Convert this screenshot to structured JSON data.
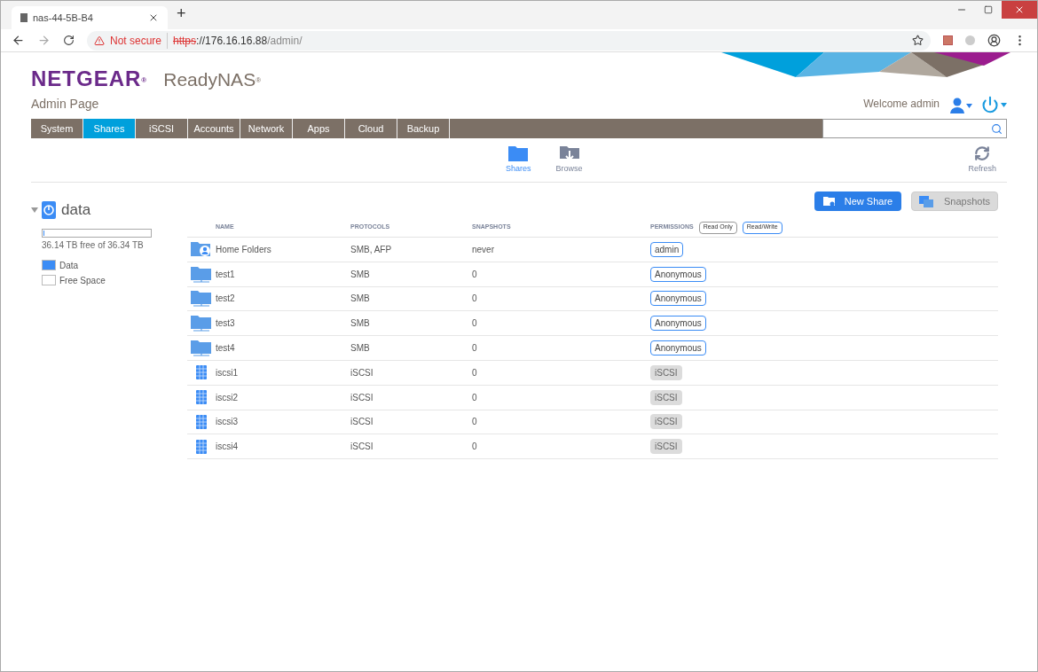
{
  "browser": {
    "tab_title": "nas-44-5B-B4",
    "new_tab": "+",
    "security": "Not secure",
    "url_scheme": "https",
    "url_rest": "://176.16.16.88",
    "url_path": "/admin/"
  },
  "header": {
    "brand": "NETGEAR",
    "brand_mark": "®",
    "product": "ReadyNAS",
    "product_mark": "®",
    "subtitle": "Admin Page",
    "welcome": "Welcome admin"
  },
  "nav": [
    {
      "label": "System",
      "selected": false
    },
    {
      "label": "Shares",
      "selected": true
    },
    {
      "label": "iSCSI",
      "selected": false
    },
    {
      "label": "Accounts",
      "selected": false
    },
    {
      "label": "Network",
      "selected": false
    },
    {
      "label": "Apps",
      "selected": false
    },
    {
      "label": "Cloud",
      "selected": false
    },
    {
      "label": "Backup",
      "selected": false
    }
  ],
  "toolbar": [
    {
      "label": "Shares",
      "kind": "shares",
      "selected": true
    },
    {
      "label": "Browse",
      "kind": "browse",
      "selected": false
    }
  ],
  "refresh": "Refresh",
  "volume": {
    "name": "data",
    "expanded": true,
    "level": 0.006,
    "free_text": "36.14 TB free of 36.34 TB",
    "legend": [
      {
        "label": "Data",
        "color": "#3b8cf5"
      },
      {
        "label": "Free Space",
        "color": "#ffffff"
      }
    ]
  },
  "actions": {
    "new_share": "New Share",
    "snapshots": "Snapshots"
  },
  "table": {
    "columns": [
      "NAME",
      "PROTOCOLS",
      "SNAPSHOTS",
      "PERMISSIONS"
    ],
    "filters": [
      {
        "label": "Read Only",
        "selected": false
      },
      {
        "label": "Read/Write",
        "selected": true
      }
    ],
    "rows": [
      {
        "kind": "home",
        "name": "Home Folders",
        "protocols": "SMB, AFP",
        "snapshots": "never",
        "permission": "admin"
      },
      {
        "kind": "folder",
        "name": "test1",
        "protocols": "SMB",
        "snapshots": "0",
        "permission": "Anonymous"
      },
      {
        "kind": "folder",
        "name": "test2",
        "protocols": "SMB",
        "snapshots": "0",
        "permission": "Anonymous"
      },
      {
        "kind": "folder",
        "name": "test3",
        "protocols": "SMB",
        "snapshots": "0",
        "permission": "Anonymous"
      },
      {
        "kind": "folder",
        "name": "test4",
        "protocols": "SMB",
        "snapshots": "0",
        "permission": "Anonymous"
      },
      {
        "kind": "iscsi",
        "name": "iscsi1",
        "protocols": "iSCSI",
        "snapshots": "0",
        "permission": "iSCSI"
      },
      {
        "kind": "iscsi",
        "name": "iscsi2",
        "protocols": "iSCSI",
        "snapshots": "0",
        "permission": "iSCSI"
      },
      {
        "kind": "iscsi",
        "name": "iscsi3",
        "protocols": "iSCSI",
        "snapshots": "0",
        "permission": "iSCSI"
      },
      {
        "kind": "iscsi",
        "name": "iscsi4",
        "protocols": "iSCSI",
        "snapshots": "0",
        "permission": "iSCSI"
      }
    ]
  }
}
